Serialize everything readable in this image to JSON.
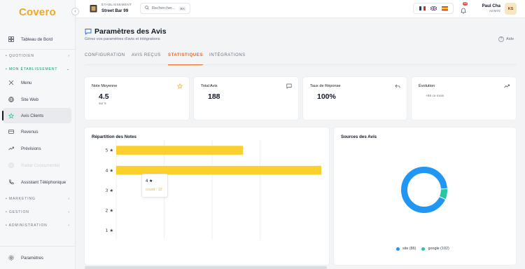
{
  "app": {
    "logo": "Covero"
  },
  "sidebar": {
    "dashboard": "Tableau de Bord",
    "sections": {
      "quotidien": "QUOTIDIEN",
      "mon_etablissement": "MON ÉTABLISSEMENT",
      "marketing": "MARKETING",
      "gestion": "GESTION",
      "administration": "ADMINISTRATION"
    },
    "items": [
      {
        "label": "Menu"
      },
      {
        "label": "Site Web"
      },
      {
        "label": "Avis Clients"
      },
      {
        "label": "Revenus"
      },
      {
        "label": "Prévisions"
      },
      {
        "label": "Radar Concurrentiel"
      },
      {
        "label": "Assistant Téléphonique"
      }
    ],
    "settings": "Paramètres"
  },
  "header": {
    "establishment_label": "ÉTABLISSEMENT",
    "establishment_name": "Street Bar 99",
    "search_placeholder": "Rechercher...",
    "search_shortcut": "⌘K",
    "notifications_count": "44",
    "user_name": "Paul Cha",
    "user_role": "ADMIN",
    "user_initials": "KS"
  },
  "page": {
    "title": "Paramètres des Avis",
    "subtitle": "Gérez vos paramètres d'avis et intégrations",
    "help": "Aide",
    "tabs": [
      "CONFIGURATION",
      "AVIS REÇUS",
      "STATISTIQUES",
      "INTÉGRATIONS"
    ],
    "active_tab": "STATISTIQUES"
  },
  "stats": [
    {
      "title": "Note Moyenne",
      "value": "4.5",
      "sub": "sur 5",
      "icon": "star-icon"
    },
    {
      "title": "Total Avis",
      "value": "188",
      "sub": "",
      "icon": "message-icon"
    },
    {
      "title": "Taux de Réponse",
      "value": "100%",
      "sub": "",
      "icon": "reply-icon"
    },
    {
      "title": "Évolution",
      "value": "",
      "sub": "+66 ce mois",
      "icon": "trend-icon"
    }
  ],
  "ratings_panel": {
    "title": "Répartition des Notes"
  },
  "sources_panel": {
    "title": "Sources des Avis"
  },
  "tooltip": {
    "title": "4 ★",
    "value": "count : 12"
  },
  "colors": {
    "accent": "#f0651e",
    "bar": "#fad02c",
    "site": "#2196f3",
    "google": "#26c6a2"
  },
  "chart_data": [
    {
      "type": "bar",
      "orientation": "horizontal",
      "title": "Répartition des Notes",
      "categories": [
        "5 ★",
        "4 ★",
        "3 ★",
        "2 ★",
        "1 ★"
      ],
      "series": [
        {
          "name": "count",
          "values": [
            60,
            97,
            0,
            0,
            0
          ]
        }
      ],
      "grid": true
    },
    {
      "type": "pie",
      "donut": true,
      "title": "Sources des Avis",
      "labels": [
        "site (86)",
        "google (102)"
      ],
      "values": [
        86,
        102
      ],
      "legend": "bottom"
    }
  ]
}
